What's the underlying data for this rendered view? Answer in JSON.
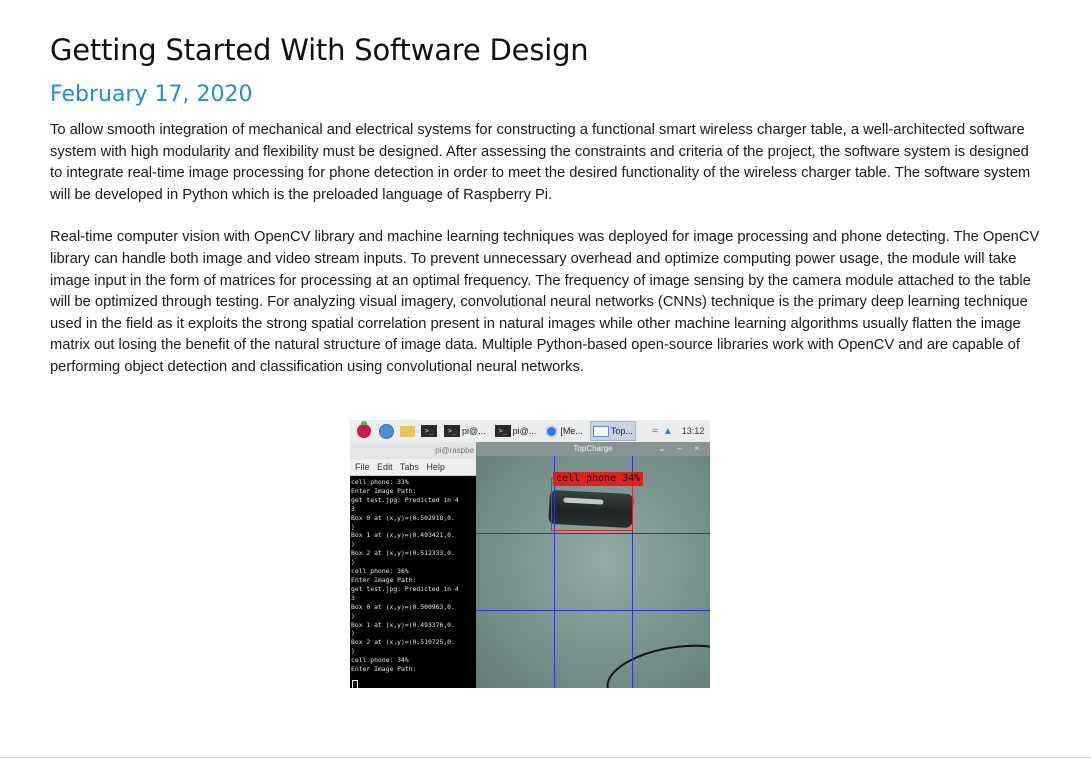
{
  "post": {
    "title": "Getting Started With Software Design",
    "date": "February 17, 2020",
    "paragraphs": [
      "To allow smooth integration of mechanical and electrical systems for constructing a functional smart wireless charger table, a well-architected software system with high modularity and flexibility must be designed. After assessing the constraints and criteria of the project, the software system is designed to integrate real-time image processing for phone detection in order to meet the desired functionality of the wireless charger table. The software system will be developed in Python which is the preloaded language of Raspberry Pi.",
      "Real-time computer vision with OpenCV library and machine learning techniques was deployed for image processing and phone detecting. The OpenCV library can handle both image and video stream inputs. To prevent unnecessary overhead and optimize computing power usage, the module will take image input in the form of matrices for processing at an optimal frequency. The frequency of image sensing by the camera module attached to the table will be optimized through testing. For analyzing visual imagery, convolutional neural networks (CNNs) technique is the primary deep learning technique used in the field as it exploits the strong spatial correlation present in natural images while other machine learning algorithms usually flatten the image matrix out losing the benefit of the natural structure of image data. Multiple Python-based open-source libraries work with OpenCV and are capable of performing object detection and classification using convolutional neural networks."
    ]
  },
  "figure": {
    "taskbar": {
      "term1_label": "pi@...",
      "term2_label": "pi@...",
      "chrome_label": "[Me...",
      "window_label": "Top...",
      "clock": "13:12"
    },
    "terminal": {
      "title": "pi@raspbe",
      "menu": [
        "File",
        "Edit",
        "Tabs",
        "Help"
      ],
      "output": "cell phone: 33%\nEnter Image Path:\nget test.jpg: Predicted in 4\n3\nBox 0 at (x,y)=(0.502918,0.\n)\nBox 1 at (x,y)=(0.493421,0.\n)\nBox 2 at (x,y)=(0.512333,0.\n)\ncell phone: 36%\nEnter Image Path:\nget test.jpg: Predicted in 4\n3\nBox 0 at (x,y)=(0.500963,0.\n)\nBox 1 at (x,y)=(0.493376,0.\n)\nBox 2 at (x,y)=(0.510725,0.\n)\ncell phone: 34%\nEnter Image Path:"
    },
    "topcharge": {
      "title": "TopCharge",
      "controls": "⌄ – ×",
      "detection_label": "cell phone 34%"
    }
  }
}
